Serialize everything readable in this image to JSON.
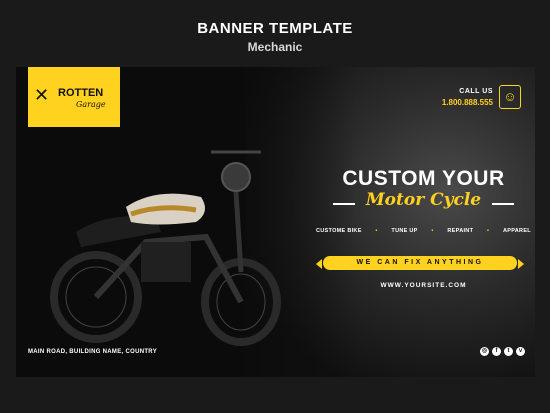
{
  "header": {
    "title": "BANNER TEMPLATE",
    "subtitle": "Mechanic"
  },
  "logo": {
    "line1": "ROTTEN",
    "line2": "Garage",
    "icon": "wrench-icon"
  },
  "contact": {
    "label": "CALL US",
    "phone": "1.800.888.555",
    "icon": "mechanic-icon"
  },
  "headline": {
    "main": "CUSTOM YOUR",
    "script": "Motor Cycle"
  },
  "services": [
    "CUSTOME BIKE",
    "TUNE UP",
    "REPAINT",
    "APPAREL"
  ],
  "tagline": "WE CAN FIX ANYTHING",
  "website": "WWW.YOURSITE.COM",
  "address": "MAIN ROAD, BUILDING NAME, COUNTRY",
  "socials": [
    "instagram-icon",
    "facebook-icon",
    "twitter-icon",
    "vimeo-icon"
  ],
  "colors": {
    "accent": "#ffd21f",
    "background": "#0b0b0b",
    "page": "#1a1a1a"
  }
}
